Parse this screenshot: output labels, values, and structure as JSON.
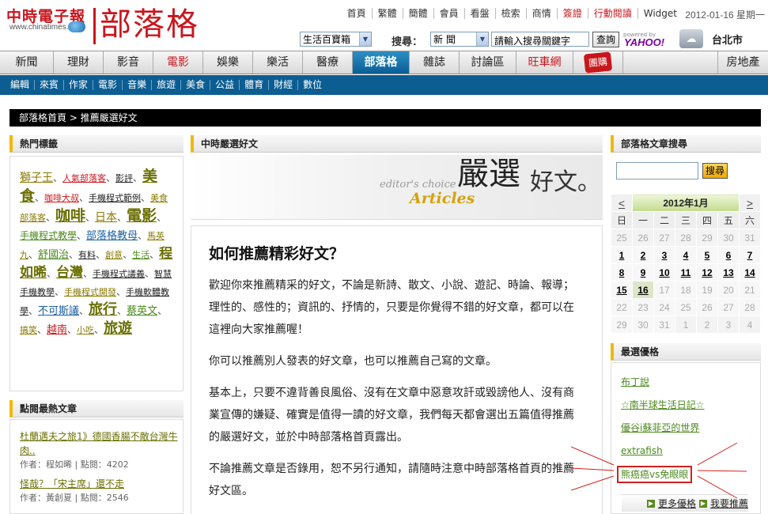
{
  "header": {
    "logo_main": "中時電子報",
    "logo_sub": "www.chinatimes.com",
    "blog_title": "部落格",
    "top_links": [
      "首頁",
      "繁體",
      "簡體",
      "會員",
      "看盤",
      "檢索",
      "商情",
      "簽證",
      "行動閱讀",
      "Widget"
    ],
    "date": "2012-01-16 星期一",
    "category_select": "生活百寶箱",
    "search_label": "搜尋：",
    "search_scope": "新 聞",
    "search_placeholder": "請輸入搜尋關鍵字",
    "search_button": "查詢",
    "powered_by": "powered by",
    "yahoo": "YAHOO!",
    "city": "台北市"
  },
  "main_nav": [
    "新聞",
    "理財",
    "影音",
    "電影",
    "娛樂",
    "樂活",
    "醫療",
    "部落格",
    "雜誌",
    "討論區",
    "旺車網",
    "房地產"
  ],
  "main_nav_badge": "團購",
  "sub_nav": [
    "編輯",
    "來賓",
    "作家",
    "電影",
    "音樂",
    "旅遊",
    "美食",
    "公益",
    "體育",
    "財經",
    "數位"
  ],
  "breadcrumb": "部落格首頁 > 推薦嚴選好文",
  "hot_tags": {
    "title": "熱門標籤",
    "tags": [
      {
        "t": "獅子王",
        "c": "",
        "s": 14
      },
      {
        "t": "人氣部落客",
        "c": "r",
        "s": 11
      },
      {
        "t": "影評",
        "c": "k",
        "s": 11
      },
      {
        "t": "美食",
        "c": "b",
        "s": 19
      },
      {
        "t": "咖啡大叔",
        "c": "r",
        "s": 11
      },
      {
        "t": "手機程式範例",
        "c": "k",
        "s": 11
      },
      {
        "t": "美食部落客",
        "c": "",
        "s": 11
      },
      {
        "t": "咖啡",
        "c": "b",
        "s": 19
      },
      {
        "t": "日本",
        "c": "",
        "s": 14
      },
      {
        "t": "電影",
        "c": "b",
        "s": 19
      },
      {
        "t": "手機程式教學",
        "c": "g",
        "s": 12
      },
      {
        "t": "部落格教母",
        "c": "bl",
        "s": 13
      },
      {
        "t": "馬英九",
        "c": "",
        "s": 11
      },
      {
        "t": "舒國治",
        "c": "g",
        "s": 13
      },
      {
        "t": "有料",
        "c": "k",
        "s": 11
      },
      {
        "t": "創意",
        "c": "",
        "s": 11
      },
      {
        "t": "生活",
        "c": "g",
        "s": 11
      },
      {
        "t": "程如晞",
        "c": "b",
        "s": 17
      },
      {
        "t": "台灣",
        "c": "b",
        "s": 17
      },
      {
        "t": "手機程式議義",
        "c": "k",
        "s": 11
      },
      {
        "t": "智慧手機教學",
        "c": "k",
        "s": 11
      },
      {
        "t": "手機程式開發",
        "c": "",
        "s": 11
      },
      {
        "t": "手機軟體教學",
        "c": "k",
        "s": 11
      },
      {
        "t": "不可斯議",
        "c": "bl",
        "s": 13
      },
      {
        "t": "旅行",
        "c": "b",
        "s": 18
      },
      {
        "t": "蔡英文",
        "c": "g",
        "s": 13
      },
      {
        "t": "搞笑",
        "c": "",
        "s": 11
      },
      {
        "t": "越南",
        "c": "r",
        "s": 13
      },
      {
        "t": "小吃",
        "c": "",
        "s": 11
      },
      {
        "t": "旅遊",
        "c": "b",
        "s": 18
      }
    ]
  },
  "most_clicked": {
    "title": "點閱最熱文章",
    "items": [
      {
        "title": "杜蘭邁夫之旅1》德國香腸不敵台灣牛肉..",
        "author": "作者：程如晞",
        "clicks": "點閱：4202"
      },
      {
        "title": "怪哉？「宋主席」還不走",
        "author": "作者：黃創夏",
        "clicks": "點閱：2546"
      }
    ]
  },
  "middle": {
    "header": "中時嚴選好文",
    "banner_en": "editor's choice",
    "banner_articles": "Articles",
    "banner_big": "嚴選",
    "banner_tail": "好文。",
    "title": "如何推薦精彩好文？",
    "paragraphs": [
      "歡迎你來推薦精采的好文，不論是新詩、散文、小說、遊記、時論、報導；理性的、感性的；資訊的、抒情的，只要是你覺得不錯的好文章，都可以在這裡向大家推薦喔！",
      "你可以推薦別人發表的好文章，也可以推薦自己寫的文章。",
      "基本上，只要不違背善良風俗、沒有在文章中惡意攻訐或毀謗他人、沒有商業宣傳的嫌疑、確實是值得一讀的好文章，我們每天都會選出五篇值得推薦的嚴選好文，並於中時部落格首頁露出。",
      "不論推薦文章是否錄用，恕不另行通知，請隨時注意中時部落格首頁的推薦好文區。"
    ]
  },
  "right": {
    "search_title": "部落格文章搜尋",
    "search_button": "搜尋",
    "calendar": {
      "prev": "<",
      "next": ">",
      "month": "2012年1月",
      "weekdays": [
        "日",
        "一",
        "二",
        "三",
        "四",
        "五",
        "六"
      ],
      "weeks": [
        [
          [
            "25",
            "dim"
          ],
          [
            "26",
            "dim"
          ],
          [
            "27",
            "dim"
          ],
          [
            "28",
            "dim"
          ],
          [
            "29",
            "dim"
          ],
          [
            "30",
            "dim"
          ],
          [
            "31",
            "dim"
          ]
        ],
        [
          [
            "1",
            "on"
          ],
          [
            "2",
            "on"
          ],
          [
            "3",
            "on"
          ],
          [
            "4",
            "on"
          ],
          [
            "5",
            "on"
          ],
          [
            "6",
            "on"
          ],
          [
            "7",
            "on"
          ]
        ],
        [
          [
            "8",
            "on"
          ],
          [
            "9",
            "on"
          ],
          [
            "10",
            "on"
          ],
          [
            "11",
            "on"
          ],
          [
            "12",
            "on"
          ],
          [
            "13",
            "on"
          ],
          [
            "14",
            "on"
          ]
        ],
        [
          [
            "15",
            "on"
          ],
          [
            "16",
            "today"
          ],
          [
            "17",
            "off"
          ],
          [
            "18",
            "off"
          ],
          [
            "19",
            "off"
          ],
          [
            "20",
            "off"
          ],
          [
            "21",
            "off"
          ]
        ],
        [
          [
            "22",
            "off"
          ],
          [
            "23",
            "off"
          ],
          [
            "24",
            "off"
          ],
          [
            "25",
            "off"
          ],
          [
            "26",
            "off"
          ],
          [
            "27",
            "off"
          ],
          [
            "28",
            "off"
          ]
        ],
        [
          [
            "29",
            "off"
          ],
          [
            "30",
            "off"
          ],
          [
            "31",
            "off"
          ],
          [
            "1",
            "dim"
          ],
          [
            "2",
            "dim"
          ],
          [
            "3",
            "dim"
          ],
          [
            "4",
            "dim"
          ]
        ]
      ]
    },
    "best_title": "最選優格",
    "best_items": [
      "布丁說",
      "☆南半球生活日記☆",
      "優谷i蘇菲亞的世界",
      "extrafish",
      "熊癌癌vs免眼眼"
    ],
    "more": "更多優格",
    "recommend": "我要推薦"
  }
}
